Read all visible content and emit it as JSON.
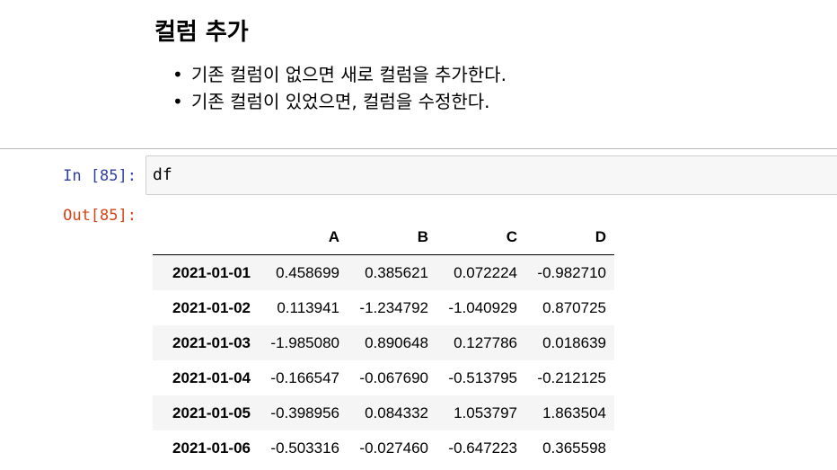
{
  "markdown": {
    "heading": "컬럼 추가",
    "bullets": [
      "기존 컬럼이 없으면 새로 컬럼을 추가한다.",
      "기존 컬럼이 있었으면, 컬럼을 수정한다."
    ]
  },
  "code_cell": {
    "in_prompt": "In [85]:",
    "code": "df",
    "out_prompt": "Out[85]:"
  },
  "dataframe": {
    "columns": [
      "",
      "A",
      "B",
      "C",
      "D"
    ],
    "rows": [
      {
        "index": "2021-01-01",
        "values": [
          "0.458699",
          "0.385621",
          "0.072224",
          "-0.982710"
        ]
      },
      {
        "index": "2021-01-02",
        "values": [
          "0.113941",
          "-1.234792",
          "-1.040929",
          "0.870725"
        ]
      },
      {
        "index": "2021-01-03",
        "values": [
          "-1.985080",
          "0.890648",
          "0.127786",
          "0.018639"
        ]
      },
      {
        "index": "2021-01-04",
        "values": [
          "-0.166547",
          "-0.067690",
          "-0.513795",
          "-0.212125"
        ]
      },
      {
        "index": "2021-01-05",
        "values": [
          "-0.398956",
          "0.084332",
          "1.053797",
          "1.863504"
        ]
      },
      {
        "index": "2021-01-06",
        "values": [
          "-0.503316",
          "-0.027460",
          "-0.647223",
          "0.365598"
        ]
      }
    ]
  }
}
